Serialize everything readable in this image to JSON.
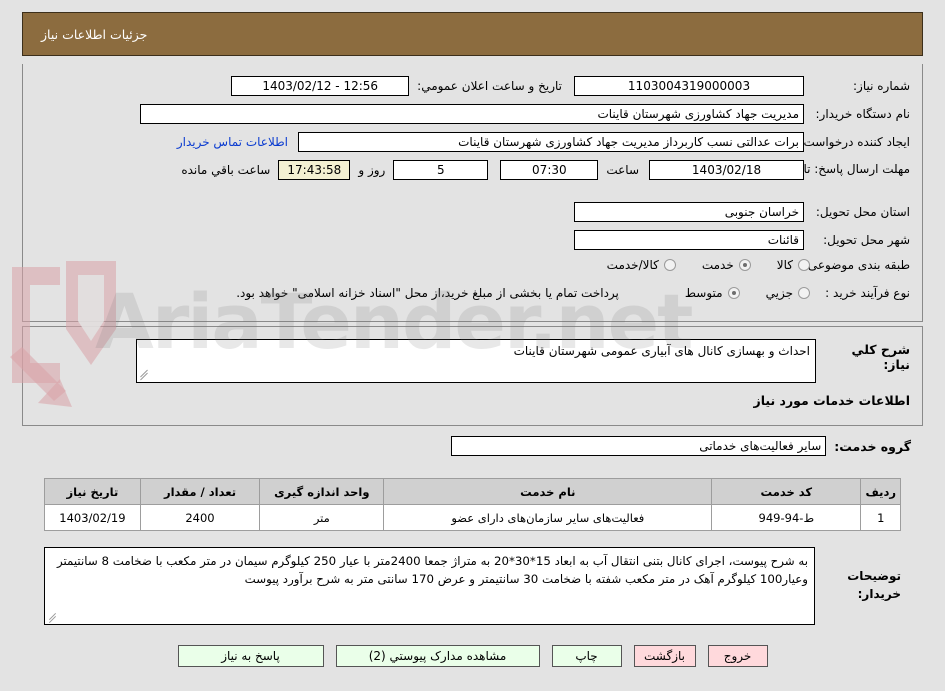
{
  "header": {
    "title": "جزئیات اطلاعات نیاز"
  },
  "form": {
    "need_number_label": "شماره نیاز:",
    "need_number_value": "1103004319000003",
    "announce_label": "تاریخ و ساعت اعلان عمومي:",
    "announce_value": "12:56 - 1403/02/12",
    "buyer_label": "نام دستگاه خریدار:",
    "buyer_value": "مدیریت جهاد کشاورزی شهرستان قاینات",
    "creator_label": "ایجاد کننده درخواست:",
    "creator_value": "برات عدالتی نسب کاربرداز مدیریت جهاد کشاورزی شهرستان قاینات",
    "contact_link": "اطلاعات تماس خریدار",
    "deadline_label": "مهلت ارسال پاسخ: تا تاریخ:",
    "deadline_date": "1403/02/18",
    "time_label": "ساعت",
    "time_value": "07:30",
    "days_value": "5",
    "days_label": "روز و",
    "countdown_value": "17:43:58",
    "countdown_label": "ساعت باقي مانده",
    "province_label": "استان محل تحویل:",
    "province_value": "خراسان جنوبی",
    "city_label": "شهر محل تحویل:",
    "city_value": "قائنات",
    "category_label": "طبقه بندی موضوعی:",
    "category_options": [
      {
        "label": "کالا",
        "selected": false
      },
      {
        "label": "خدمت",
        "selected": true
      },
      {
        "label": "کالا/خدمت",
        "selected": false
      }
    ],
    "process_label": "نوع فرآیند خرید :",
    "process_options": [
      {
        "label": "جزیي",
        "selected": false
      },
      {
        "label": "متوسط",
        "selected": true
      }
    ],
    "treasury_note": "پرداخت تمام یا بخشی از مبلغ خرید،از محل \"اسناد خزانه اسلامی\" خواهد بود."
  },
  "overview": {
    "need_desc_label": "شرح کلي نیاز:",
    "need_desc_value": "احداث و بهسازی کانال های آبیاری عمومی شهرستان قاینات",
    "services_heading": "اطلاعات خدمات مورد نیاز",
    "service_group_label": "گروه خدمت:",
    "service_group_value": "سایر فعالیت‌های خدماتی"
  },
  "table": {
    "columns": [
      "ردیف",
      "کد خدمت",
      "نام خدمت",
      "واحد اندازه گیری",
      "تعداد / مقدار",
      "تاریخ نیاز"
    ],
    "rows": [
      {
        "index": "1",
        "code": "ط-94-949",
        "name": "فعالیت‌های سایر سازمان‌های دارای عضو",
        "unit": "متر",
        "quantity": "2400",
        "date": "1403/02/19"
      }
    ]
  },
  "description": {
    "label": "توضیحات خریدار:",
    "text": "به شرح پیوست، اجرای کانال بتنی انتقال آب به ابعاد 15*30*20 به متراژ جمعا 2400متر با عیار 250 کیلوگرم سیمان در متر مکعب  با ضخامت 8 سانتیمتر وعیار100 کیلوگرم آهک در متر مکعب شفته با ضخامت 30 سانتیمتر و عرض 170 سانتی متر به شرح برآورد پیوست"
  },
  "buttons": [
    {
      "label": "خروج",
      "style": "pink"
    },
    {
      "label": "بازگشت",
      "style": "pink"
    },
    {
      "label": "چاپ",
      "style": "green"
    },
    {
      "label": "مشاهده مدارک پیوستي (2)",
      "style": "green"
    },
    {
      "label": "پاسخ به نیاز",
      "style": "green"
    }
  ],
  "watermark": {
    "text": "AriaTender.net"
  },
  "colors": {
    "header_bg": "#8c6c3f",
    "page_bg": "#e3e3e3",
    "field_bg": "#ffffff",
    "countdown_bg": "#f3f0d2",
    "link": "#0a3bd0",
    "button_green": "#eaffe9",
    "button_pink": "#ffd9dc",
    "table_header_bg": "#d0d0d0",
    "watermark_pink": "#d9a3a8"
  }
}
